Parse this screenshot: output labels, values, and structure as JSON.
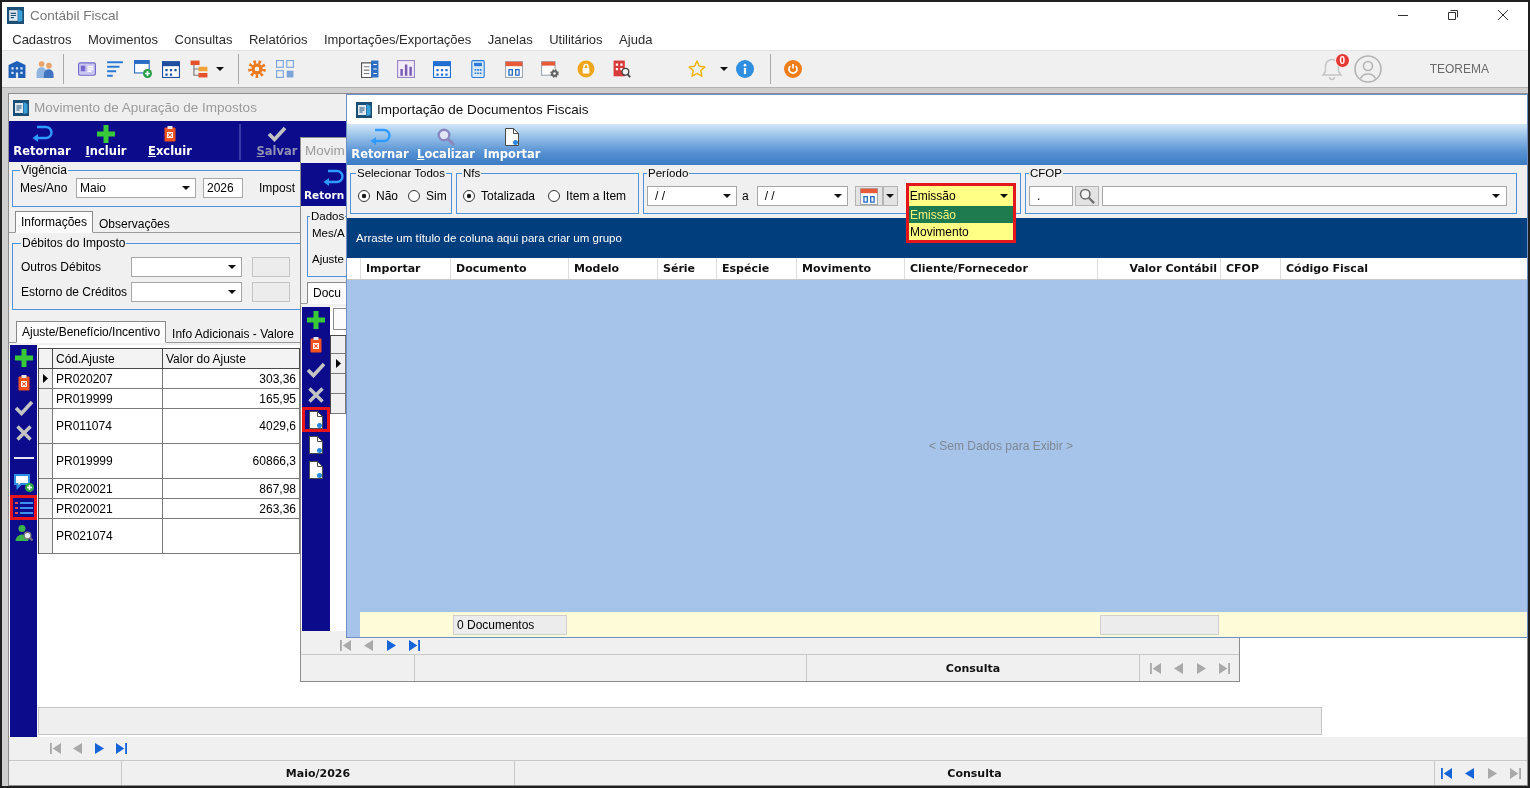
{
  "app": {
    "title": "Contábil Fiscal",
    "menu": [
      "Cadastros",
      "Movimentos",
      "Consultas",
      "Relatórios",
      "Importações/Exportações",
      "Janelas",
      "Utilitários",
      "Ajuda"
    ],
    "notification_count": "0",
    "user": "TEOREMA"
  },
  "apuracao_window": {
    "title": "Movimento de Apuração de Impostos",
    "active": false,
    "toolbar": [
      {
        "kind": "back",
        "label": "Retornar",
        "disabled": false,
        "shortcut_underlined": false
      },
      {
        "kind": "add",
        "label": "Incluir",
        "disabled": false,
        "shortcut_underlined": true
      },
      {
        "kind": "delete",
        "label": "Excluir",
        "disabled": false,
        "shortcut_underlined": true
      },
      {
        "kind": "save",
        "label": "Salvar",
        "disabled": true,
        "shortcut_underlined": true
      }
    ],
    "vigencia": {
      "legend": "Vigência",
      "period_label": "Mes/Ano",
      "month": "Maio",
      "year": "2026",
      "tax_label": "Impost"
    },
    "tabs": [
      {
        "label": "Informações",
        "selected": true
      },
      {
        "label": "Observações",
        "selected": false
      }
    ],
    "debitos": {
      "legend": "Débitos do Imposto",
      "fields": [
        {
          "label": "Outros Débitos"
        },
        {
          "label": "Estorno de Créditos"
        }
      ]
    },
    "subtabs": [
      {
        "label": "Ajuste/Benefício/Incentivo",
        "selected": true
      },
      {
        "label": "Info Adicionais - Valore",
        "selected": false
      }
    ],
    "side_tools": [
      {
        "kind": "add",
        "highlighted": false,
        "disabled": false
      },
      {
        "kind": "delete",
        "highlighted": false,
        "disabled": false
      },
      {
        "kind": "confirm",
        "highlighted": false,
        "disabled": true
      },
      {
        "kind": "cancel",
        "highlighted": false,
        "disabled": true
      },
      {
        "kind": "separator"
      },
      {
        "kind": "note",
        "highlighted": false,
        "disabled": false
      },
      {
        "kind": "list",
        "highlighted": true,
        "disabled": false
      },
      {
        "kind": "search",
        "highlighted": false,
        "disabled": false
      }
    ],
    "table": {
      "columns": [
        "Cód.Ajuste",
        "Valor do Ajuste"
      ],
      "rows": [
        {
          "code": "PR020207",
          "value": "303,36",
          "selected": true,
          "kind": "short"
        },
        {
          "code": "PR019999",
          "value": "165,95",
          "selected": false,
          "kind": "short"
        },
        {
          "code": "PR011074",
          "value": "4029,6",
          "selected": false,
          "kind": "tall"
        },
        {
          "code": "PR019999",
          "value": "60866,3",
          "selected": false,
          "kind": "tall"
        },
        {
          "code": "PR020021",
          "value": "867,98",
          "selected": false,
          "kind": "short"
        },
        {
          "code": "PR020021",
          "value": "263,36",
          "selected": false,
          "kind": "short"
        },
        {
          "code": "PR021074",
          "selected": false,
          "kind": "tall"
        }
      ]
    },
    "navigator": [
      {
        "kind": "first",
        "disabled": true
      },
      {
        "kind": "previous",
        "disabled": true
      },
      {
        "kind": "next",
        "disabled": false
      },
      {
        "kind": "last",
        "disabled": false
      }
    ],
    "status_bar": {
      "period": "Maio/2026",
      "mode": "Consulta",
      "navigator": [
        {
          "kind": "first",
          "disabled": false
        },
        {
          "kind": "previous",
          "disabled": false
        },
        {
          "kind": "next",
          "disabled": true
        },
        {
          "kind": "last",
          "disabled": true
        }
      ]
    }
  },
  "movimento_window": {
    "title": "Movim",
    "active": false,
    "toolbar": [
      {
        "kind": "back",
        "label": "Retorn",
        "disabled": false,
        "shortcut_underlined": false
      }
    ],
    "dados": {
      "legend": "Dados",
      "labels": [
        "Mes/A",
        "Ajuste"
      ]
    },
    "tabs": [
      {
        "label": "Docu",
        "selected": true
      }
    ],
    "side_tools": [
      {
        "kind": "add",
        "highlighted": false,
        "disabled": false
      },
      {
        "kind": "delete",
        "highlighted": false,
        "disabled": false
      },
      {
        "kind": "confirm",
        "highlighted": false,
        "disabled": true
      },
      {
        "kind": "cancel",
        "highlighted": false,
        "disabled": true
      },
      {
        "kind": "import",
        "highlighted": true,
        "disabled": false
      },
      {
        "kind": "import",
        "highlighted": false,
        "disabled": false
      },
      {
        "kind": "import",
        "highlighted": false,
        "disabled": false
      }
    ],
    "grid_rows": [
      {
        "selected": true
      },
      {
        "selected": false
      },
      {
        "selected": false
      }
    ],
    "navigator": [
      {
        "kind": "first",
        "disabled": true
      },
      {
        "kind": "previous",
        "disabled": true
      },
      {
        "kind": "next",
        "disabled": false
      },
      {
        "kind": "last",
        "disabled": false
      }
    ],
    "status_bar": {
      "mode": "Consulta",
      "navigator": [
        {
          "kind": "first",
          "disabled": true
        },
        {
          "kind": "previous",
          "disabled": true
        },
        {
          "kind": "next",
          "disabled": true
        },
        {
          "kind": "last",
          "disabled": true
        }
      ]
    }
  },
  "importacao_window": {
    "title": "Importação de Documentos Fiscais",
    "active": true,
    "toolbar": [
      {
        "kind": "back",
        "label": "Retornar",
        "disabled": false,
        "shortcut_underlined": false
      },
      {
        "kind": "search",
        "label": "Localizar",
        "disabled": false,
        "shortcut_underlined": true
      },
      {
        "kind": "import",
        "label": "Importar",
        "disabled": false,
        "shortcut_underlined": false
      }
    ],
    "select_all": {
      "legend": "Selecionar Todos",
      "options": [
        {
          "label": "Não",
          "selected": true
        },
        {
          "label": "Sim",
          "selected": false
        }
      ]
    },
    "nfs": {
      "legend": "Nfs",
      "options": [
        {
          "label": "Totalizada",
          "selected": true
        },
        {
          "label": "Item a Item",
          "selected": false
        }
      ]
    },
    "period": {
      "legend": "Período",
      "from": "/ /",
      "separator": "a",
      "to": "/ /",
      "date_type": {
        "value": "Emissão",
        "open": true,
        "highlighted": true,
        "options": [
          {
            "label": "Emissão",
            "selected": true
          },
          {
            "label": "Movimento",
            "selected": false
          }
        ]
      }
    },
    "cfop": {
      "legend": "CFOP",
      "code": "."
    },
    "group_panel": "Arraste um título de coluna aqui para criar um grupo",
    "grid": {
      "columns": [
        {
          "label": "Importar",
          "kind": "text",
          "has_summary": false
        },
        {
          "label": "Documento",
          "kind": "text",
          "has_summary": true,
          "summary": "0 Documentos"
        },
        {
          "label": "Modelo",
          "kind": "text",
          "has_summary": false
        },
        {
          "label": "Série",
          "kind": "text",
          "has_summary": false
        },
        {
          "label": "Espécie",
          "kind": "text",
          "has_summary": false
        },
        {
          "label": "Movimento",
          "kind": "text",
          "has_summary": false
        },
        {
          "label": "Cliente/Fornecedor",
          "kind": "text",
          "has_summary": false
        },
        {
          "label": "Valor Contábil",
          "kind": "number",
          "has_summary": true
        },
        {
          "label": "CFOP",
          "kind": "text",
          "has_summary": false
        },
        {
          "label": "Código Fiscal",
          "kind": "text",
          "has_summary": false
        }
      ],
      "empty_text": "< Sem Dados para Exibir >"
    }
  }
}
